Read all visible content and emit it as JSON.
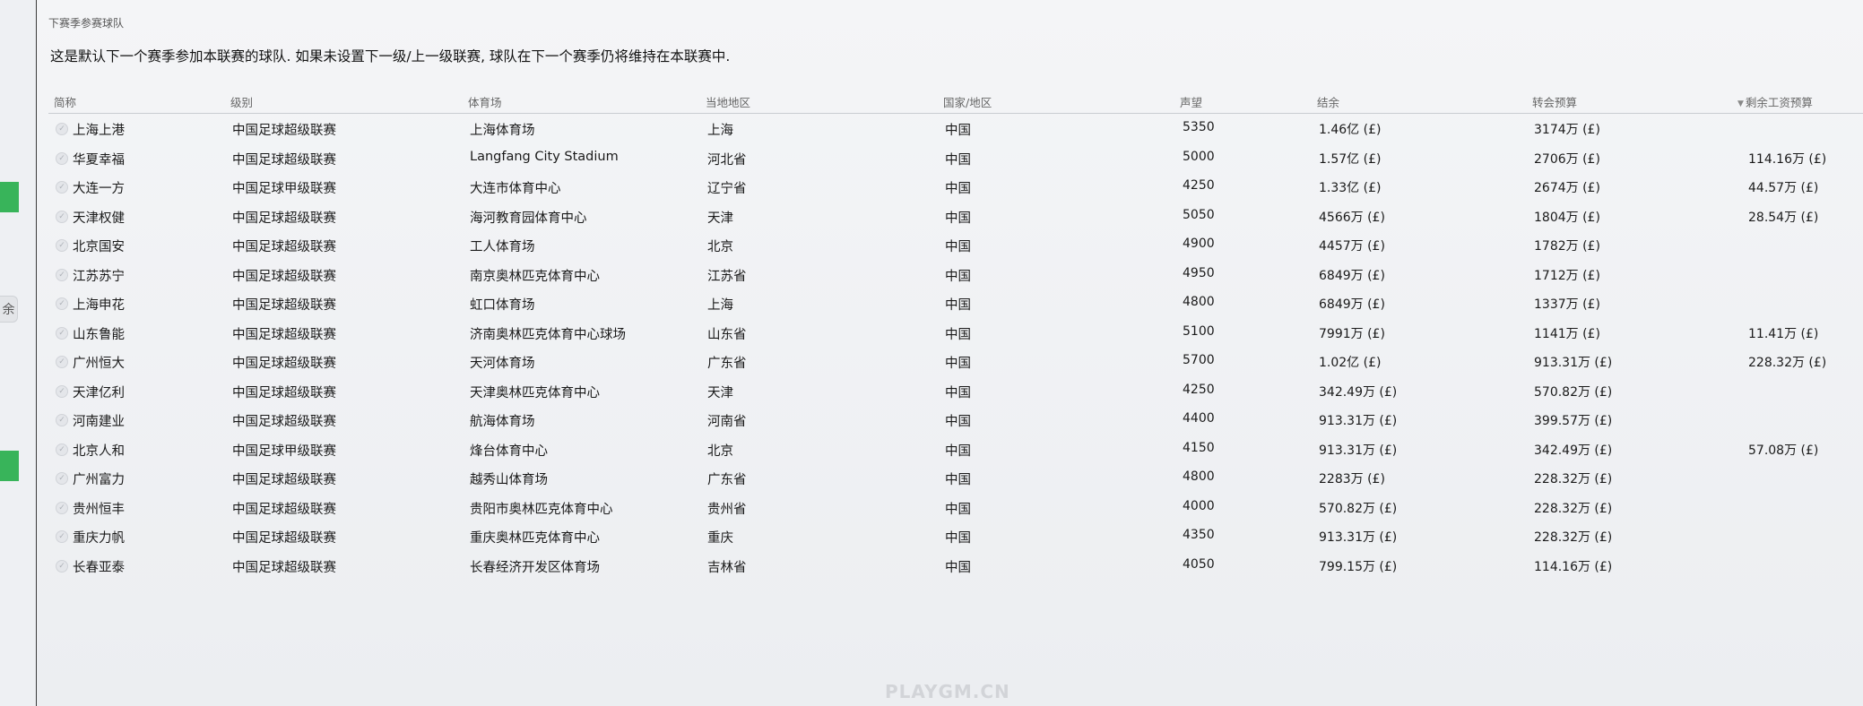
{
  "left_tab_label": "余",
  "panel_title": "下赛季参赛球队",
  "description": "这是默认下一个赛季参加本联赛的球队. 如果未设置下一级/上一级联赛, 球队在下一个赛季仍将维持在本联赛中.",
  "columns": {
    "name": "简称",
    "level": "级别",
    "stadium": "体育场",
    "region": "当地地区",
    "country": "国家/地区",
    "reputation": "声望",
    "balance": "结余",
    "transfer": "转会预算",
    "wage": "剩余工资预算"
  },
  "rows": [
    {
      "name": "上海上港",
      "level": "中国足球超级联赛",
      "stadium": "上海体育场",
      "region": "上海",
      "country": "中国",
      "reputation": "5350",
      "balance": "1.46亿 (£)",
      "transfer": "3174万 (£)",
      "wage": ""
    },
    {
      "name": "华夏幸福",
      "level": "中国足球超级联赛",
      "stadium": "Langfang City Stadium",
      "region": "河北省",
      "country": "中国",
      "reputation": "5000",
      "balance": "1.57亿 (£)",
      "transfer": "2706万 (£)",
      "wage": "114.16万 (£)"
    },
    {
      "name": "大连一方",
      "level": "中国足球甲级联赛",
      "stadium": "大连市体育中心",
      "region": "辽宁省",
      "country": "中国",
      "reputation": "4250",
      "balance": "1.33亿 (£)",
      "transfer": "2674万 (£)",
      "wage": "44.57万 (£)"
    },
    {
      "name": "天津权健",
      "level": "中国足球超级联赛",
      "stadium": "海河教育园体育中心",
      "region": "天津",
      "country": "中国",
      "reputation": "5050",
      "balance": "4566万 (£)",
      "transfer": "1804万 (£)",
      "wage": "28.54万 (£)"
    },
    {
      "name": "北京国安",
      "level": "中国足球超级联赛",
      "stadium": "工人体育场",
      "region": "北京",
      "country": "中国",
      "reputation": "4900",
      "balance": "4457万 (£)",
      "transfer": "1782万 (£)",
      "wage": ""
    },
    {
      "name": "江苏苏宁",
      "level": "中国足球超级联赛",
      "stadium": "南京奥林匹克体育中心",
      "region": "江苏省",
      "country": "中国",
      "reputation": "4950",
      "balance": "6849万 (£)",
      "transfer": "1712万 (£)",
      "wage": ""
    },
    {
      "name": "上海申花",
      "level": "中国足球超级联赛",
      "stadium": "虹口体育场",
      "region": "上海",
      "country": "中国",
      "reputation": "4800",
      "balance": "6849万 (£)",
      "transfer": "1337万 (£)",
      "wage": ""
    },
    {
      "name": "山东鲁能",
      "level": "中国足球超级联赛",
      "stadium": "济南奥林匹克体育中心球场",
      "region": "山东省",
      "country": "中国",
      "reputation": "5100",
      "balance": "7991万 (£)",
      "transfer": "1141万 (£)",
      "wage": "11.41万 (£)"
    },
    {
      "name": "广州恒大",
      "level": "中国足球超级联赛",
      "stadium": "天河体育场",
      "region": "广东省",
      "country": "中国",
      "reputation": "5700",
      "balance": "1.02亿 (£)",
      "transfer": "913.31万 (£)",
      "wage": "228.32万 (£)"
    },
    {
      "name": "天津亿利",
      "level": "中国足球超级联赛",
      "stadium": "天津奥林匹克体育中心",
      "region": "天津",
      "country": "中国",
      "reputation": "4250",
      "balance": "342.49万 (£)",
      "transfer": "570.82万 (£)",
      "wage": ""
    },
    {
      "name": "河南建业",
      "level": "中国足球超级联赛",
      "stadium": "航海体育场",
      "region": "河南省",
      "country": "中国",
      "reputation": "4400",
      "balance": "913.31万 (£)",
      "transfer": "399.57万 (£)",
      "wage": ""
    },
    {
      "name": "北京人和",
      "level": "中国足球甲级联赛",
      "stadium": "烽台体育中心",
      "region": "北京",
      "country": "中国",
      "reputation": "4150",
      "balance": "913.31万 (£)",
      "transfer": "342.49万 (£)",
      "wage": "57.08万 (£)"
    },
    {
      "name": "广州富力",
      "level": "中国足球超级联赛",
      "stadium": "越秀山体育场",
      "region": "广东省",
      "country": "中国",
      "reputation": "4800",
      "balance": "2283万 (£)",
      "transfer": "228.32万 (£)",
      "wage": ""
    },
    {
      "name": "贵州恒丰",
      "level": "中国足球超级联赛",
      "stadium": "贵阳市奥林匹克体育中心",
      "region": "贵州省",
      "country": "中国",
      "reputation": "4000",
      "balance": "570.82万 (£)",
      "transfer": "228.32万 (£)",
      "wage": ""
    },
    {
      "name": "重庆力帆",
      "level": "中国足球超级联赛",
      "stadium": "重庆奥林匹克体育中心",
      "region": "重庆",
      "country": "中国",
      "reputation": "4350",
      "balance": "913.31万 (£)",
      "transfer": "228.32万 (£)",
      "wage": ""
    },
    {
      "name": "长春亚泰",
      "level": "中国足球超级联赛",
      "stadium": "长春经济开发区体育场",
      "region": "吉林省",
      "country": "中国",
      "reputation": "4050",
      "balance": "799.15万 (£)",
      "transfer": "114.16万 (£)",
      "wage": ""
    }
  ],
  "watermark": "PLAYGM.CN",
  "colors": {
    "accent_green": "#38b45a"
  }
}
